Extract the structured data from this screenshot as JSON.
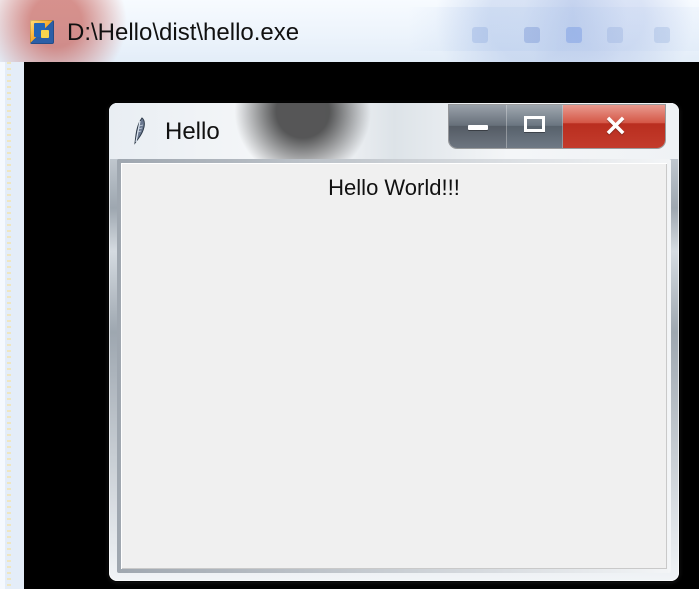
{
  "console": {
    "title": "D:\\Hello\\dist\\hello.exe"
  },
  "app": {
    "title": "Hello",
    "message": "Hello World!!!"
  },
  "colors": {
    "console_background": "#000000",
    "close_button": "#c33b2c",
    "client_background": "#f0f0f0"
  },
  "icons": {
    "console": "python-console-icon",
    "app": "feather-icon",
    "minimize": "minimize-icon",
    "maximize": "maximize-icon",
    "close": "close-icon"
  }
}
